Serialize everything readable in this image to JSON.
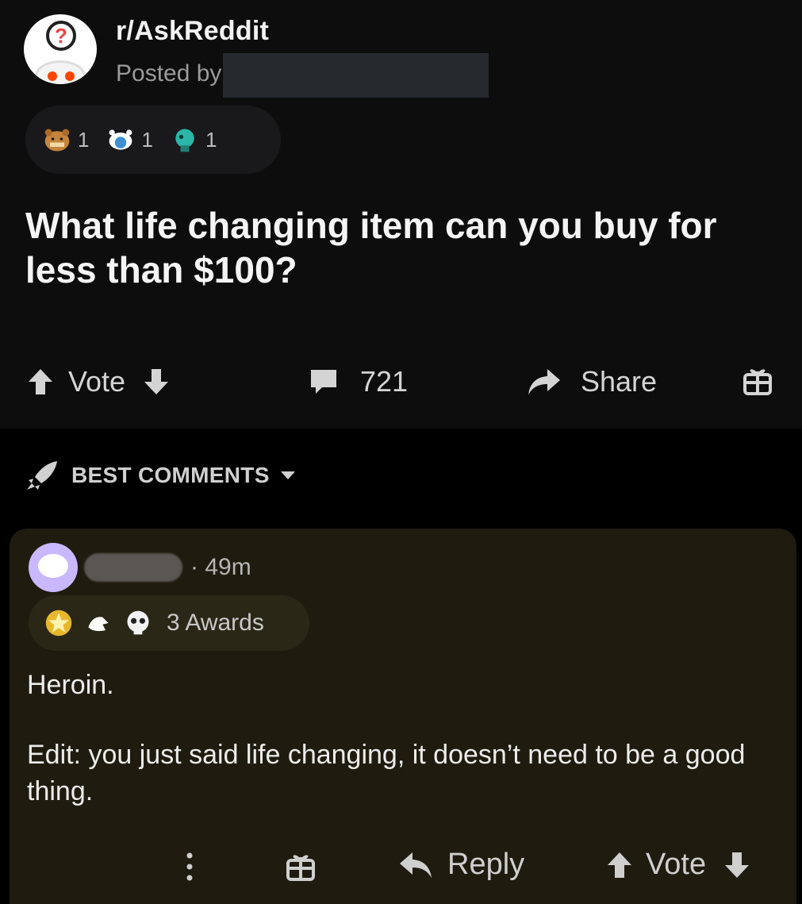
{
  "post": {
    "subreddit": "r/AskReddit",
    "posted_by_label": "Posted by",
    "awards": [
      {
        "icon": "bear-award-icon",
        "count": "1",
        "color": "#c7843b"
      },
      {
        "icon": "snoo-award-icon",
        "count": "1",
        "color": "#3b8fd4"
      },
      {
        "icon": "teal-award-icon",
        "count": "1",
        "color": "#2bb6a8"
      }
    ],
    "title": "What life changing item can you buy for less than $100?",
    "actions": {
      "vote_label": "Vote",
      "comment_count": "721",
      "share_label": "Share"
    }
  },
  "sort": {
    "label": "BEST COMMENTS"
  },
  "comment": {
    "time": "49m",
    "awards_label": "3 Awards",
    "body": [
      "Heroin.",
      "Edit: you just said life changing, it doesn’t need to be a good thing."
    ],
    "actions": {
      "reply_label": "Reply",
      "vote_label": "Vote"
    }
  },
  "colors": {
    "background": "#000000",
    "post_bg": "#0d0d0e",
    "comment_bg": "#1f1c0f",
    "text": "#e8e8e8"
  }
}
